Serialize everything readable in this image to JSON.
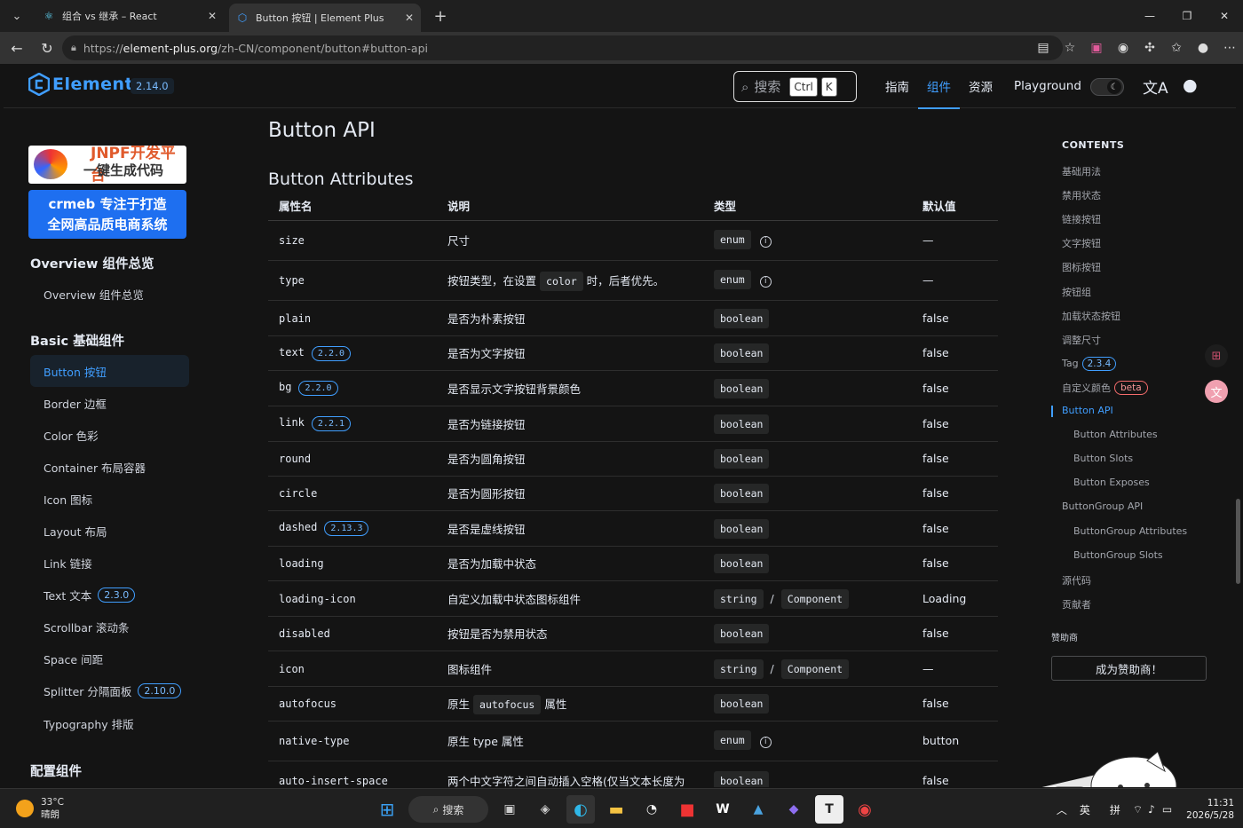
{
  "browser": {
    "tabs": [
      {
        "title": "组合 vs 继承 – React",
        "active": false
      },
      {
        "title": "Button 按钮 | Element Plus",
        "active": true
      }
    ],
    "url": {
      "scheme": "https://",
      "host": "element-plus.org",
      "path": "/zh-CN/component/button#button-api"
    }
  },
  "site": {
    "logo_text": "Element",
    "version": "2.14.0",
    "search": {
      "placeholder": "搜索",
      "kbd1": "Ctrl",
      "kbd2": "K"
    },
    "nav": [
      "指南",
      "组件",
      "资源",
      "Playground"
    ],
    "nav_active": "组件"
  },
  "sidebar": {
    "ad1": {
      "line1": "JNPF开发平台",
      "line2": "一键生成代码"
    },
    "ad2": {
      "line1": "crmeb 专注于打造",
      "line2": "全网高品质电商系统"
    },
    "groups": [
      {
        "title": "Overview 组件总览",
        "items": [
          {
            "label": "Overview 组件总览"
          }
        ]
      },
      {
        "title": "Basic 基础组件",
        "items": [
          {
            "label": "Button 按钮",
            "active": true
          },
          {
            "label": "Border 边框"
          },
          {
            "label": "Color 色彩"
          },
          {
            "label": "Container 布局容器"
          },
          {
            "label": "Icon 图标"
          },
          {
            "label": "Layout 布局"
          },
          {
            "label": "Link 链接"
          },
          {
            "label": "Text 文本",
            "badge": "2.3.0"
          },
          {
            "label": "Scrollbar 滚动条"
          },
          {
            "label": "Space 间距"
          },
          {
            "label": "Splitter 分隔面板",
            "badge": "2.10.0"
          },
          {
            "label": "Typography 排版"
          }
        ]
      },
      {
        "title": "配置组件",
        "items": []
      }
    ]
  },
  "content": {
    "page_title": "Button API",
    "section_title": "Button Attributes",
    "columns": [
      "属性名",
      "说明",
      "类型",
      "默认值"
    ],
    "rows": [
      {
        "name": "size",
        "desc": "尺寸",
        "type": [
          "enum"
        ],
        "info": true,
        "default": "—"
      },
      {
        "name": "type",
        "desc_pre": "按钮类型，在设置",
        "desc_code": "color",
        "desc_post": "时，后者优先。",
        "type": [
          "enum"
        ],
        "info": true,
        "default": "—"
      },
      {
        "name": "plain",
        "desc": "是否为朴素按钮",
        "type": [
          "boolean"
        ],
        "default": "false"
      },
      {
        "name": "text",
        "badge": "2.2.0",
        "desc": "是否为文字按钮",
        "type": [
          "boolean"
        ],
        "default": "false"
      },
      {
        "name": "bg",
        "badge": "2.2.0",
        "desc": "是否显示文字按钮背景颜色",
        "type": [
          "boolean"
        ],
        "default": "false"
      },
      {
        "name": "link",
        "badge": "2.2.1",
        "desc": "是否为链接按钮",
        "type": [
          "boolean"
        ],
        "default": "false"
      },
      {
        "name": "round",
        "desc": "是否为圆角按钮",
        "type": [
          "boolean"
        ],
        "default": "false"
      },
      {
        "name": "circle",
        "desc": "是否为圆形按钮",
        "type": [
          "boolean"
        ],
        "default": "false"
      },
      {
        "name": "dashed",
        "badge": "2.13.3",
        "desc": "是否是虚线按钮",
        "type": [
          "boolean"
        ],
        "default": "false"
      },
      {
        "name": "loading",
        "desc": "是否为加载中状态",
        "type": [
          "boolean"
        ],
        "default": "false"
      },
      {
        "name": "loading-icon",
        "desc": "自定义加载中状态图标组件",
        "type": [
          "string",
          "Component"
        ],
        "default": "Loading"
      },
      {
        "name": "disabled",
        "desc": "按钮是否为禁用状态",
        "type": [
          "boolean"
        ],
        "default": "false"
      },
      {
        "name": "icon",
        "desc": "图标组件",
        "type": [
          "string",
          "Component"
        ],
        "default": "—"
      },
      {
        "name": "autofocus",
        "desc_pre": "原生",
        "desc_code": "autofocus",
        "desc_post": "属性",
        "type": [
          "boolean"
        ],
        "default": "false"
      },
      {
        "name": "native-type",
        "desc": "原生 type 属性",
        "type": [
          "enum"
        ],
        "info": true,
        "default": "button"
      },
      {
        "name": "auto-insert-space",
        "desc": "两个中文字符之间自动插入空格(仅当文本长度为",
        "type": [
          "boolean"
        ],
        "default": "false"
      }
    ]
  },
  "toc": {
    "heading": "CONTENTS",
    "items": [
      {
        "label": "基础用法"
      },
      {
        "label": "禁用状态"
      },
      {
        "label": "链接按钮"
      },
      {
        "label": "文字按钮"
      },
      {
        "label": "图标按钮"
      },
      {
        "label": "按钮组"
      },
      {
        "label": "加载状态按钮"
      },
      {
        "label": "调整尺寸"
      },
      {
        "label": "Tag",
        "badge": "2.3.4"
      },
      {
        "label": "自定义颜色",
        "beta": "beta"
      },
      {
        "label": "Button API",
        "active": true
      },
      {
        "label": "Button Attributes",
        "sub": true
      },
      {
        "label": "Button Slots",
        "sub": true
      },
      {
        "label": "Button Exposes",
        "sub": true
      },
      {
        "label": "ButtonGroup API"
      },
      {
        "label": "ButtonGroup Attributes",
        "sub": true
      },
      {
        "label": "ButtonGroup Slots",
        "sub": true
      },
      {
        "label": "源代码"
      },
      {
        "label": "贡献者"
      }
    ],
    "sponsor_heading": "赞助商",
    "sponsor_button": "成为赞助商！"
  },
  "taskbar": {
    "weather": {
      "temp": "33°C",
      "cond": "晴朗"
    },
    "search_label": "搜索",
    "ime1": "英",
    "ime2": "拼",
    "time": "11:31",
    "date": "2026/5/28"
  },
  "colors": {
    "accent": "#409eff",
    "bg": "#141414",
    "danger": "#f56c6c"
  }
}
